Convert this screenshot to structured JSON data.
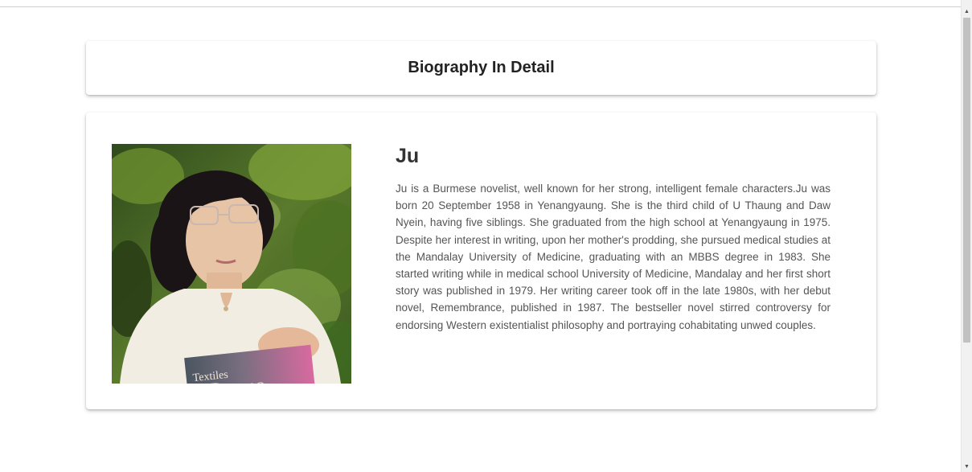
{
  "header": {
    "title": "Biography In Detail"
  },
  "biography": {
    "name": "Ju",
    "text": "Ju is a Burmese novelist, well known for her strong, intelligent female characters.Ju was born 20 September 1958 in Yenangyaung. She is the third child of U Thaung and Daw Nyein, having five siblings. She graduated from the high school at Yenangyaung in 1975. Despite her interest in writing, upon her mother's prodding, she pursued medical studies at the Mandalay University of Medicine, graduating with an MBBS degree in 1983. She started writing while in medical school University of Medicine, Mandalay and her first short story was published in 1979. Her writing career took off in the late 1980s, with her debut novel, Remembrance, published in 1987. The bestseller novel stirred controversy for endorsing Western existentialist philosophy and portraying cohabitating unwed couples.",
    "photo": {
      "book_title_line1": "Textiles",
      "book_title_small": "from",
      "book_title_line2": "Burma"
    }
  },
  "colors": {
    "card_background": "#ffffff",
    "title_text": "#222222",
    "body_text": "#555555",
    "scrollbar_thumb": "#c1c1c1"
  }
}
